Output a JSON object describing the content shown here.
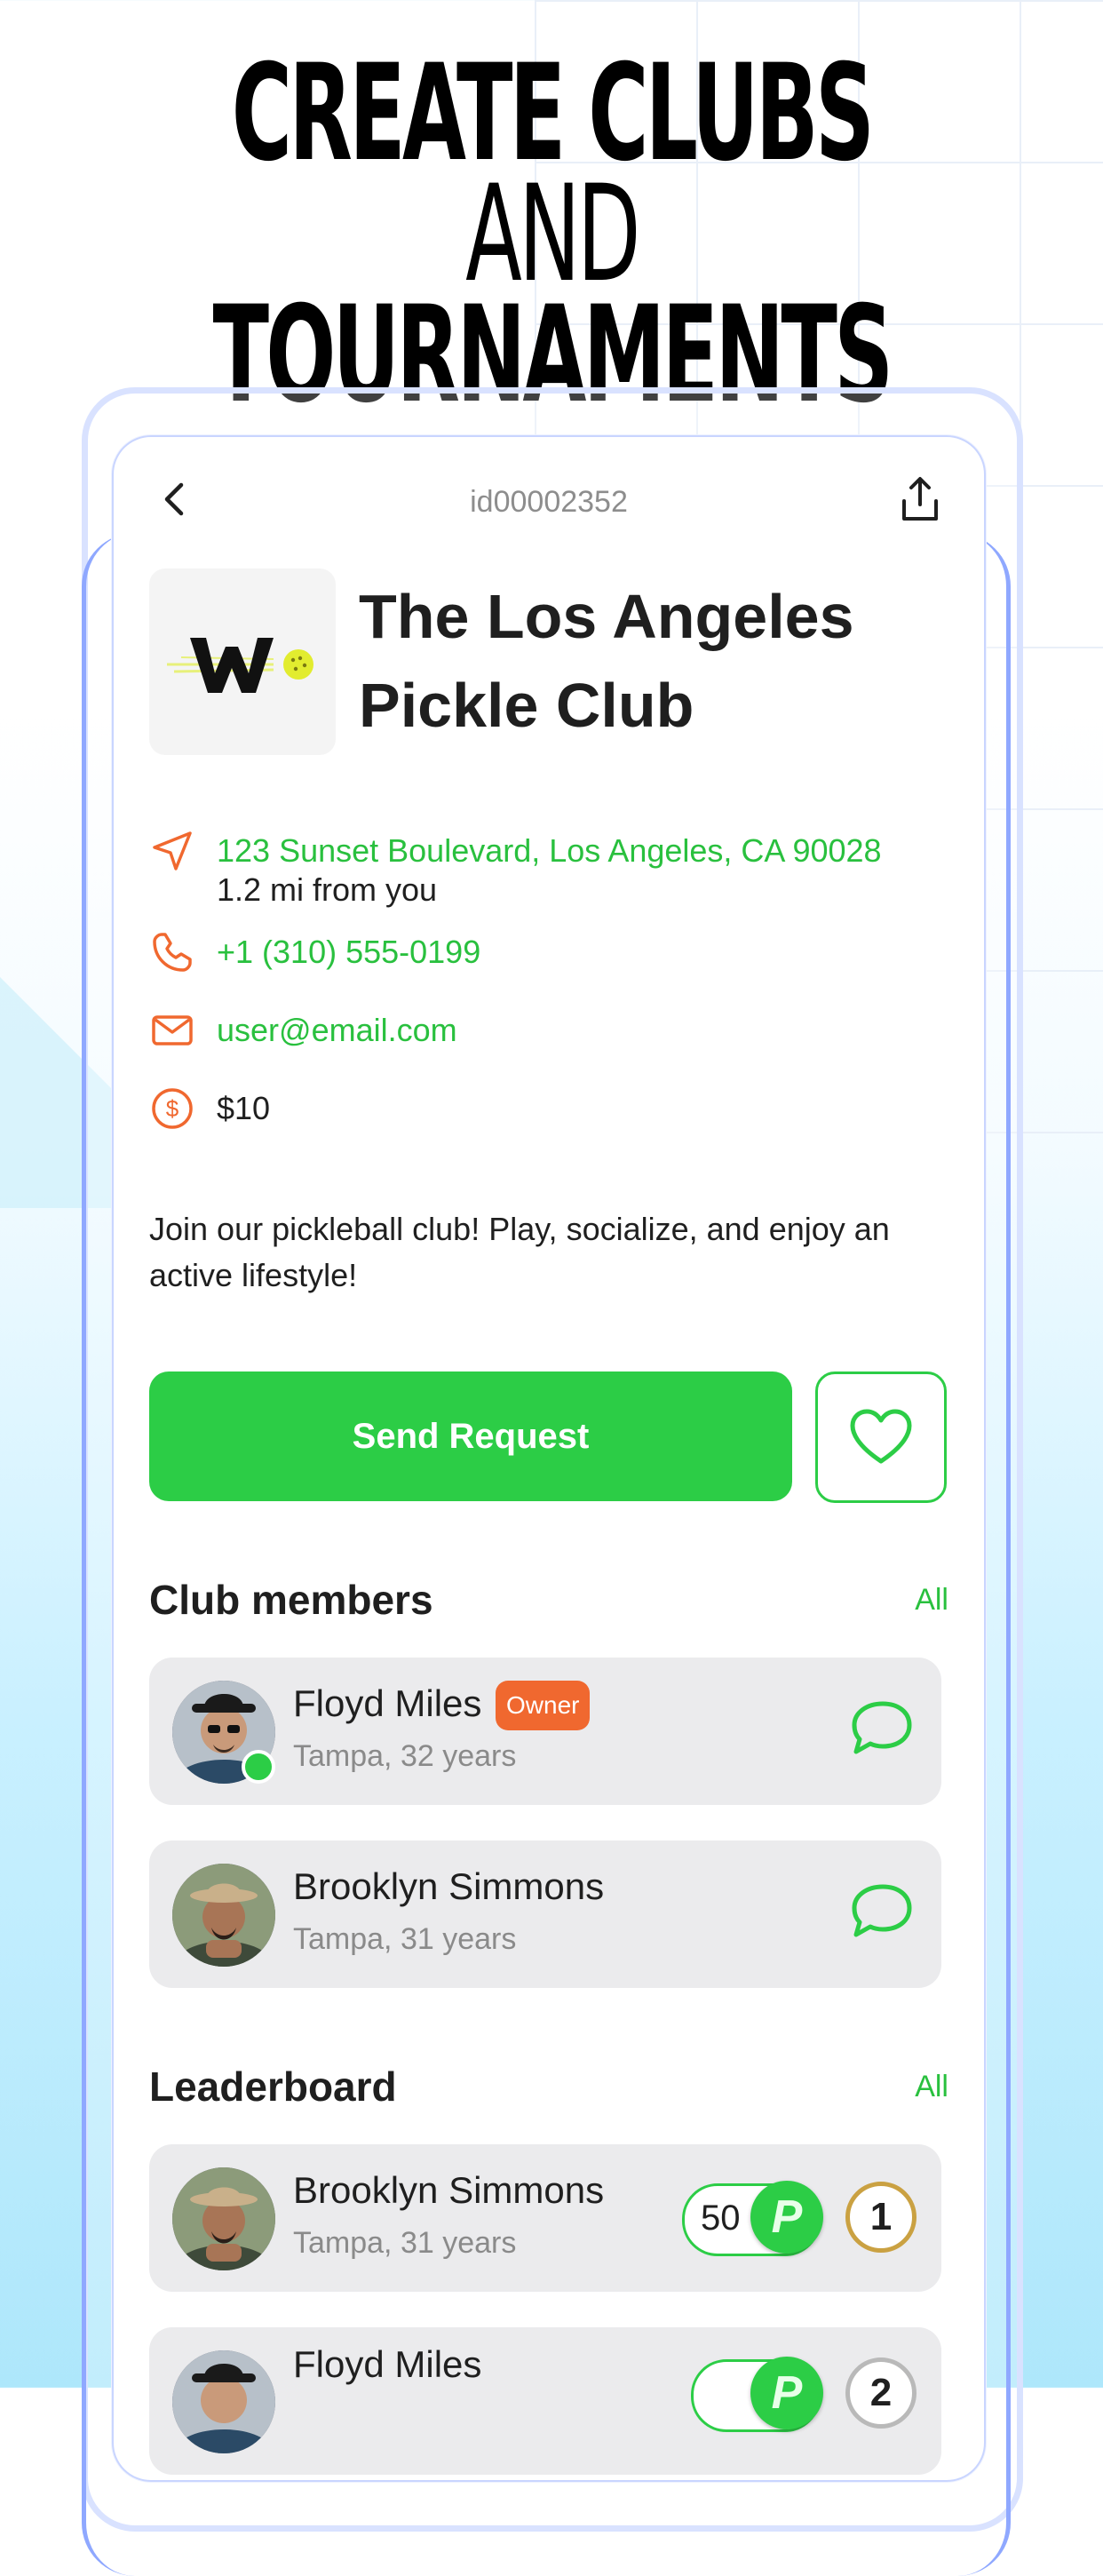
{
  "headline": {
    "line1_bold": "CREATE CLUBS",
    "line1_thin": "AND",
    "line2": "TOURNAMENTS"
  },
  "topbar": {
    "id": "id00002352",
    "back_icon": "chevron-left-icon",
    "share_icon": "share-icon"
  },
  "club": {
    "name": "The Los Angeles Pickle Club",
    "address": "123 Sunset Boulevard, Los Angeles, CA 90028",
    "distance": "1.2 mi from you",
    "phone": "+1 (310) 555-0199",
    "email": "user@email.com",
    "price": "$10",
    "description": "Join our pickleball club! Play, socialize, and enjoy an active lifestyle!"
  },
  "actions": {
    "send_request": "Send Request",
    "favorite_icon": "heart-icon"
  },
  "members_section": {
    "title": "Club members",
    "all": "All",
    "members": [
      {
        "name": "Floyd Miles",
        "badge": "Owner",
        "sub": "Tampa, 32 years",
        "online": true
      },
      {
        "name": "Brooklyn Simmons",
        "sub": "Tampa, 31 years",
        "online": false
      }
    ]
  },
  "leaderboard": {
    "title": "Leaderboard",
    "all": "All",
    "entries": [
      {
        "name": "Brooklyn Simmons",
        "sub": "Tampa, 31 years",
        "points": "50",
        "coin": "P",
        "rank": "1"
      },
      {
        "name": "Floyd Miles",
        "sub": "",
        "points": "",
        "coin": "P",
        "rank": "2"
      }
    ]
  },
  "colors": {
    "accent": "#2ccd46",
    "icon_orange": "#f0682f",
    "badge": "#f0682f"
  }
}
